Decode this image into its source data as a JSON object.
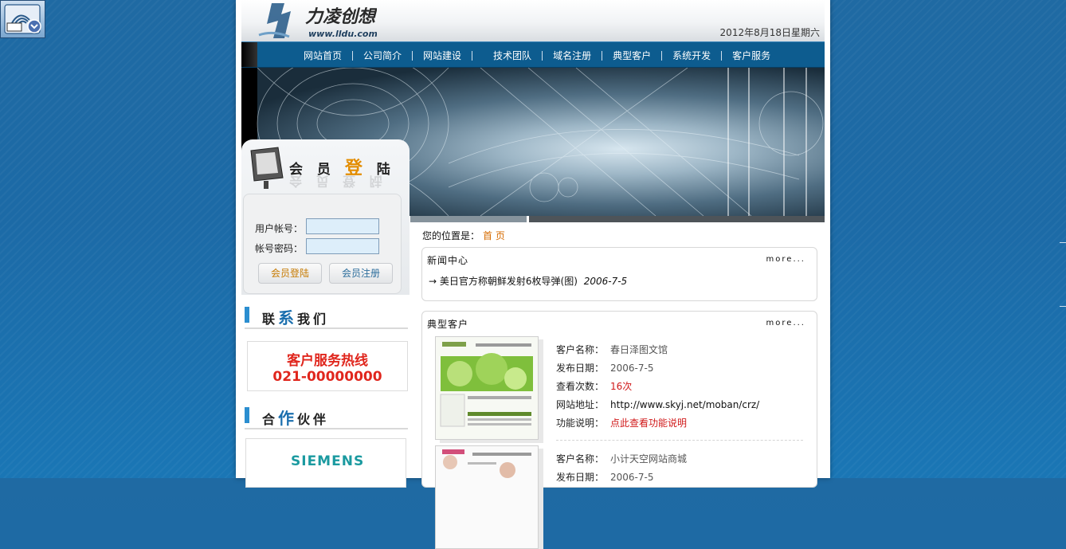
{
  "header": {
    "date": "2012年8月18日星期六",
    "logo_text": "力凌创想",
    "logo_url": "www.lldu.com"
  },
  "nav": {
    "items": [
      "网站首页",
      "公司简介",
      "网站建设",
      "技术团队",
      "域名注册",
      "典型客户",
      "系统开发",
      "客户服务"
    ]
  },
  "login": {
    "title_part1": "会 员",
    "title_highlight": "登",
    "title_part2": "陆",
    "username_label": "用户帐号：",
    "password_label": "帐号密码：",
    "login_button": "会员登陆",
    "register_button": "会员注册"
  },
  "contact": {
    "title_pre": "联",
    "title_big": "系",
    "title_post": "我们",
    "hotline_label": "客户服务热线",
    "hotline_number": "021-00000000"
  },
  "partners": {
    "title_pre": "合",
    "title_big": "作",
    "title_post": "伙伴",
    "partner_name": "SIEMENS"
  },
  "breadcrumb": {
    "label": "您的位置是：",
    "current": "首 页"
  },
  "news": {
    "title": "新闻中心",
    "more": "more...",
    "items": [
      {
        "arrow": "→",
        "text": "美日官方称朝鲜发射6枚导弹(图)",
        "date": "2006-7-5"
      }
    ]
  },
  "clients": {
    "title": "典型客户",
    "more": "more...",
    "labels": {
      "name": "客户名称：",
      "date": "发布日期：",
      "views": "查看次数：",
      "url": "网站地址：",
      "desc": "功能说明："
    },
    "items": [
      {
        "name": "春日泽图文馆",
        "date": "2006-7-5",
        "views": "16次",
        "url": "http://www.skyj.net/moban/crz/",
        "desc": "点此查看功能说明"
      },
      {
        "name": "小计天空网站商城",
        "date": "2006-7-5"
      }
    ]
  }
}
